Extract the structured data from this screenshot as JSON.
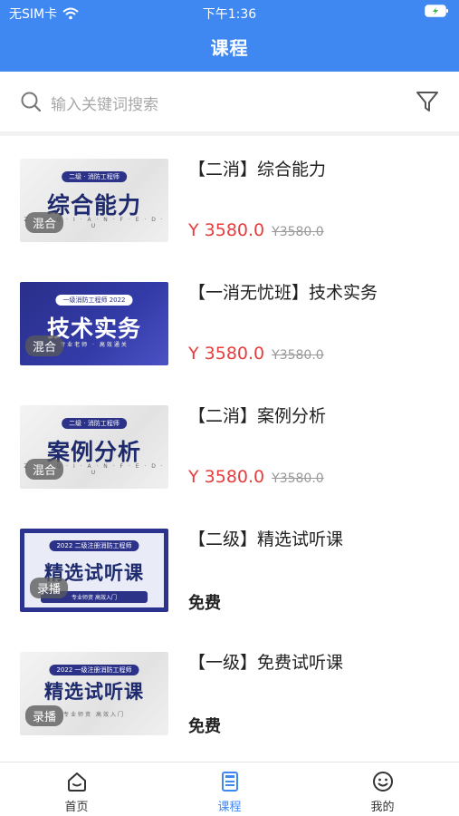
{
  "status_bar": {
    "carrier": "无SIM卡",
    "time": "下午1:36"
  },
  "nav": {
    "title": "课程"
  },
  "search": {
    "placeholder": "输入关键词搜索"
  },
  "colors": {
    "primary": "#3f88f1",
    "price": "#e53d3d",
    "tab_active": "#3f88f1",
    "tab_inactive": "#333333"
  },
  "courses": [
    {
      "title": "【二消】综合能力",
      "price": "Y 3580.0",
      "original_price": "Y3580.0",
      "badge": "混合",
      "thumb": {
        "pill": "二级 · 消防工程师",
        "title": "综合能力",
        "sub": "Z · G · Q · I · A · N · F · E · D · U"
      }
    },
    {
      "title": "【一消无忧班】技术实务",
      "price": "Y 3580.0",
      "original_price": "Y3580.0",
      "badge": "混合",
      "thumb": {
        "pill": "一级消防工程师 2022",
        "title": "技术实务",
        "sub": "专业老师 · 高效通关"
      }
    },
    {
      "title": "【二消】案例分析",
      "price": "Y 3580.0",
      "original_price": "Y3580.0",
      "badge": "混合",
      "thumb": {
        "pill": "二级 · 消防工程师",
        "title": "案例分析",
        "sub": "Z · G · Q · I · A · N · F · E · D · U"
      }
    },
    {
      "title": "【二级】精选试听课",
      "free": "免费",
      "badge": "录播",
      "thumb": {
        "pill": "2022 二级注册消防工程师",
        "title": "精选试听课",
        "sub": "专业师资 高效入门"
      }
    },
    {
      "title": "【一级】免费试听课",
      "free": "免费",
      "badge": "录播",
      "thumb": {
        "pill": "2022 一级注册消防工程师",
        "title": "精选试听课",
        "sub": "专业师资 高效入门"
      }
    }
  ],
  "tabs": [
    {
      "label": "首页",
      "icon": "home-icon",
      "active": false
    },
    {
      "label": "课程",
      "icon": "course-book-icon",
      "active": true
    },
    {
      "label": "我的",
      "icon": "smiley-profile-icon",
      "active": false
    }
  ]
}
